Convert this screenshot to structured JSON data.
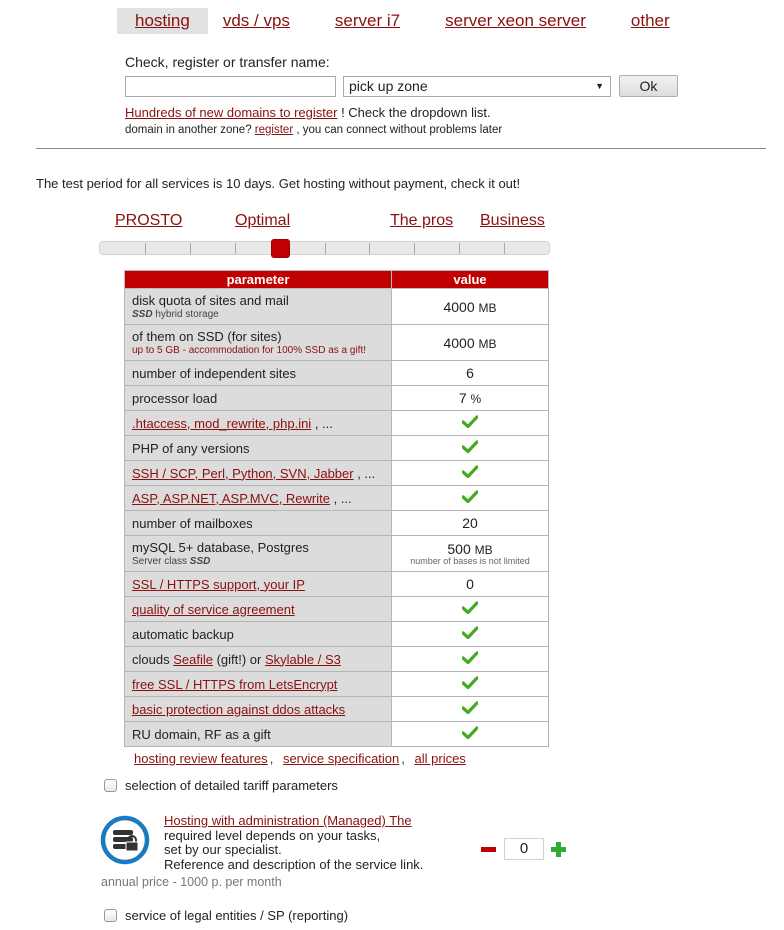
{
  "nav": {
    "tabs": [
      {
        "label": "hosting",
        "active": true
      },
      {
        "label": "vds / vps",
        "active": false
      },
      {
        "label": "server i7",
        "active": false
      },
      {
        "label": "server xeon server",
        "active": false
      },
      {
        "label": "other",
        "active": false
      }
    ]
  },
  "domain": {
    "title": "Check, register or transfer name:",
    "name_value": "",
    "zone_selected": "pick up zone",
    "ok_label": "Ok",
    "promo_link": "Hundreds of new domains to register",
    "promo_text": " ! Check the dropdown list.",
    "other_zone_prefix": "domain in another zone? ",
    "other_zone_link": "register",
    "other_zone_suffix": " , you can connect without problems later"
  },
  "test_period": "The test period for all services is 10 days. Get hosting without payment, check it out!",
  "plans": {
    "labels": [
      "PROSTO",
      "Optimal",
      "The pros",
      "Business"
    ],
    "slider_steps": 10,
    "slider_value_fraction": 0.4
  },
  "table": {
    "headers": {
      "parameter": "parameter",
      "value": "value"
    },
    "rows": [
      {
        "param": "disk quota of sites and mail",
        "sub_bold": "SSD",
        "sub": " hybrid storage",
        "value": "4000",
        "unit": "MB"
      },
      {
        "param": "of them on SSD (for sites)",
        "sub_red": "up to 5 GB - accommodation for 100% SSD as a gift!",
        "value": "4000",
        "unit": "MB"
      },
      {
        "param": "number of independent sites",
        "value": "6"
      },
      {
        "param": "processor load",
        "value": "7",
        "unit": "%"
      },
      {
        "param_links": [
          ".htaccess, mod_rewrite, php.ini"
        ],
        "param_suffix": " , ...",
        "check": true
      },
      {
        "param": "PHP of any versions",
        "check": true
      },
      {
        "param_links": [
          "SSH / SCP, Perl, Python, SVN, Jabber"
        ],
        "param_suffix": " , ...",
        "check": true
      },
      {
        "param_links": [
          "ASP, ASP.NET, ASP.MVC, Rewrite"
        ],
        "param_suffix": " , ...",
        "check": true
      },
      {
        "param": "number of mailboxes",
        "value": "20"
      },
      {
        "param": "mySQL 5+ database, Postgres",
        "sub": "Server class ",
        "sub_bold_after": "SSD",
        "value": "500",
        "unit": "MB",
        "value_sub": "number of bases is not limited"
      },
      {
        "param_links": [
          "SSL / HTTPS support, your IP"
        ],
        "value": "0"
      },
      {
        "param_links": [
          "quality of service agreement"
        ],
        "check": true
      },
      {
        "param": "automatic backup",
        "check": true
      },
      {
        "param_prefix": "clouds ",
        "param_links": [
          "Seafile",
          "Skylable / S3"
        ],
        "param_between": " (gift!) or ",
        "check": true
      },
      {
        "param_links": [
          "free SSL / HTTPS from LetsEncrypt"
        ],
        "check": true
      },
      {
        "param_links": [
          "basic protection against ddos attacks"
        ],
        "check": true
      },
      {
        "param": "RU domain, RF as a gift",
        "check": true
      }
    ]
  },
  "under_links": [
    "hosting review features",
    "service specification",
    "all prices"
  ],
  "detailed_checkbox": {
    "label": "selection of detailed tariff parameters",
    "checked": false
  },
  "managed": {
    "icon": "server-lock-icon",
    "link": "Hosting with administration (Managed) The",
    "lines": [
      "required level depends on your tasks,",
      "set by our specialist.",
      "Reference and description of the service link."
    ],
    "price": "annual price - 1000 p. per month",
    "quantity": "0"
  },
  "legal_checkbox": {
    "label": "service of legal entities / SP (reporting)",
    "checked": false
  },
  "colors": {
    "accent": "#c00000",
    "link": "#8b1010",
    "check": "#44aa22",
    "icon_ring": "#1a7bbf"
  }
}
